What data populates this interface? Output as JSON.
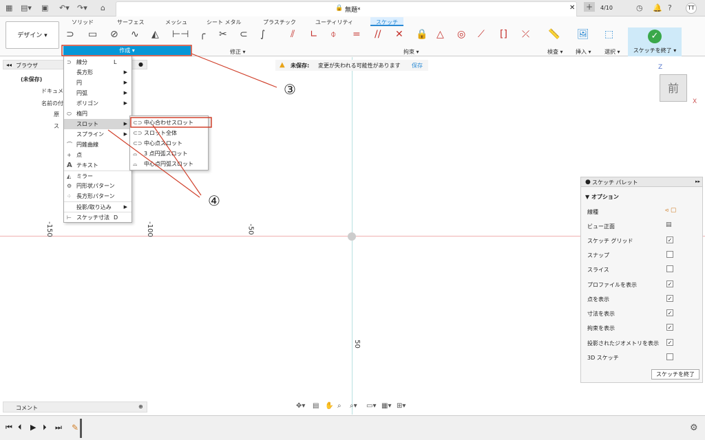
{
  "topbar": {
    "doc_title": "無題*",
    "version": "4/10",
    "user": "TT"
  },
  "ribbon": {
    "tabs": [
      "ソリッド",
      "サーフェス",
      "メッシュ",
      "シート メタル",
      "プラスチック",
      "ユーティリティ"
    ],
    "active_tab": "スケッチ",
    "design": "デザイン ▾",
    "groups": {
      "create": "作成 ▾",
      "modify": "修正 ▾",
      "constraints": "拘束 ▾",
      "inspect": "検査 ▾",
      "insert": "挿入 ▾",
      "select": "選択 ▾",
      "finish": "スケッチを終了 ▾"
    }
  },
  "warning": {
    "label": "未保存:",
    "text": "変更が失われる可能性があります",
    "save": "保存"
  },
  "browser": {
    "title": "ブラウザ",
    "items": [
      "(未保存)",
      "ドキュメ",
      "名前の付",
      "原",
      "ス"
    ]
  },
  "menu": {
    "items": [
      {
        "label": "線分",
        "shortcut": "L"
      },
      {
        "label": "長方形"
      },
      {
        "label": "円"
      },
      {
        "label": "円弧"
      },
      {
        "label": "ポリゴン"
      },
      {
        "label": "楕円"
      },
      {
        "label": "スロット"
      },
      {
        "label": "スプライン"
      },
      {
        "label": "円錐曲線"
      },
      {
        "label": "点"
      },
      {
        "label": "テキスト"
      },
      {
        "label": "ミラー"
      },
      {
        "label": "円形状パターン"
      },
      {
        "label": "長方形パターン"
      },
      {
        "label": "投影/取り込み"
      },
      {
        "label": "スケッチ寸法",
        "shortcut": "D"
      }
    ]
  },
  "submenu": {
    "items": [
      "中心合わせスロット",
      "スロット全体",
      "中心点スロット",
      "3 点円弧スロット",
      "中心点円弧スロット"
    ]
  },
  "annotations": {
    "a3": "③",
    "a4": "④"
  },
  "axes": {
    "x_labels": [
      "-150",
      "-100",
      "-50"
    ],
    "y_label": "50",
    "view_cube": "前",
    "z": "Z",
    "x": "X"
  },
  "palette": {
    "title": "スケッチ パレット",
    "section": "オプション",
    "rows": [
      {
        "label": "線種"
      },
      {
        "label": "ビュー正面"
      },
      {
        "label": "スケッチ グリッド",
        "checked": true
      },
      {
        "label": "スナップ",
        "checked": false
      },
      {
        "label": "スライス",
        "checked": false
      },
      {
        "label": "プロファイルを表示",
        "checked": true
      },
      {
        "label": "点を表示",
        "checked": true
      },
      {
        "label": "寸法を表示",
        "checked": true
      },
      {
        "label": "拘束を表示",
        "checked": true
      },
      {
        "label": "投影されたジオメトリを表示",
        "checked": true
      },
      {
        "label": "3D スケッチ",
        "checked": false
      }
    ],
    "finish": "スケッチを終了"
  },
  "comments": {
    "label": "コメント"
  }
}
